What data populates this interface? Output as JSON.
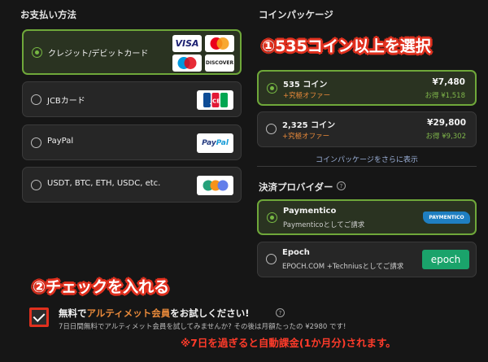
{
  "payment": {
    "title": "お支払い方法",
    "methods": [
      {
        "label": "クレジット/デビットカード"
      },
      {
        "label": "JCBカード"
      },
      {
        "label": "PayPal"
      },
      {
        "label": "USDT, BTC, ETH, USDC, etc."
      }
    ]
  },
  "logos": {
    "visa": "VISA",
    "discover": "DISCOVER",
    "jcb": "JCB",
    "paypal_a": "Pay",
    "paypal_b": "Pal"
  },
  "coins": {
    "title": "コインパッケージ",
    "packages": [
      {
        "name": "535 コイン",
        "promo": "+究極オファー",
        "price": "¥7,480",
        "save": "お得 ¥1,518"
      },
      {
        "name": "2,325 コイン",
        "promo": "+究極オファー",
        "price": "¥29,800",
        "save": "お得 ¥9,302"
      }
    ],
    "more_link": "コインパッケージをさらに表示"
  },
  "provider": {
    "title": "決済プロバイダー",
    "help": "?",
    "items": [
      {
        "name": "Paymentico",
        "sub": "Paymenticoとしてご請求",
        "badge": "PAYMENTICO"
      },
      {
        "name": "Epoch",
        "sub": "EPOCH.COM +Techniusとしてご請求",
        "badge": "epoch"
      }
    ]
  },
  "trial": {
    "prefix": "無料で",
    "accent": "アルティメット会員",
    "suffix": "をお試しください!",
    "help": "?",
    "desc": "7日日間無料でアルティメット会員を試してみませんか? その後は月額たったの ¥2980 です!"
  },
  "annotations": {
    "step1": "①535コイン以上を選択",
    "step2": "②チェックを入れる",
    "note": "※7日を過ぎると自動課金(1か月分)されます。"
  },
  "colors": {
    "accent_green": "#6fa83a",
    "promo_orange": "#e8893a",
    "annotation_red": "#e0301e"
  }
}
